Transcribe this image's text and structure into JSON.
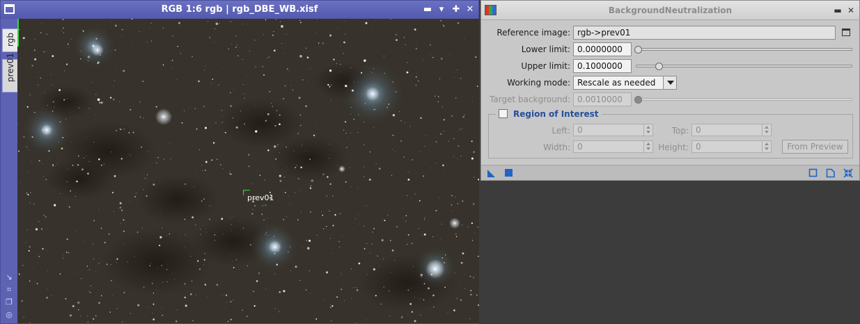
{
  "image_window": {
    "title": "RGB 1:6 rgb | rgb_DBE_WB.xisf",
    "tabs": [
      {
        "label": "rgb",
        "active": true
      },
      {
        "label": "prev01",
        "active": false
      }
    ],
    "preview_label": "prev01",
    "title_buttons": [
      "shade-icon",
      "minimize-icon",
      "maximize-icon",
      "close-icon"
    ],
    "side_icons": [
      "mask-link-icon",
      "fit-view-icon",
      "clone-icon",
      "target-icon"
    ]
  },
  "dialog": {
    "title": "BackgroundNeutralization",
    "reference_image": {
      "label": "Reference image:",
      "value": "rgb->prev01"
    },
    "lower_limit": {
      "label": "Lower limit:",
      "value": "0.0000000",
      "level": 0.0
    },
    "upper_limit": {
      "label": "Upper limit:",
      "value": "0.1000000",
      "level": 0.1
    },
    "working_mode": {
      "label": "Working mode:",
      "value": "Rescale as needed"
    },
    "target_background": {
      "label": "Target background:",
      "value": "0.0010000",
      "level": 0.0
    },
    "roi": {
      "title": "Region of Interest",
      "checked": false,
      "left": {
        "label": "Left:",
        "value": "0"
      },
      "top": {
        "label": "Top:",
        "value": "0"
      },
      "width": {
        "label": "Width:",
        "value": "0"
      },
      "height": {
        "label": "Height:",
        "value": "0"
      },
      "from_preview": "From Preview"
    }
  },
  "colors": {
    "window_frame": "#5d63b2",
    "preview_marker": "#39d839",
    "roi_title": "#244f9a",
    "action_icon": "#1f64c8"
  }
}
